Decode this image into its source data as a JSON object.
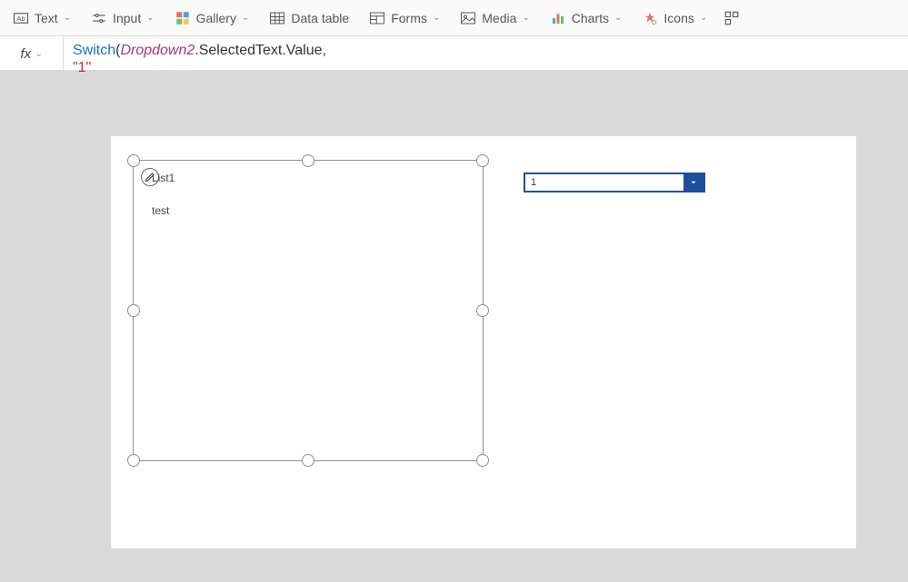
{
  "toolbar": {
    "items": [
      {
        "label": "Text"
      },
      {
        "label": "Input"
      },
      {
        "label": "Gallery"
      },
      {
        "label": "Data table"
      },
      {
        "label": "Forms"
      },
      {
        "label": "Media"
      },
      {
        "label": "Charts"
      },
      {
        "label": "Icons"
      }
    ]
  },
  "formulaBar": {
    "fxLabel": "fx",
    "formula_fn": "Switch",
    "formula_paren_open": "(",
    "formula_obj": "Dropdown2",
    "formula_props": ".SelectedText.Value",
    "formula_comma": ",",
    "formula_line2": "\"1\""
  },
  "gallery": {
    "title": "List1",
    "item": "test"
  },
  "dropdown": {
    "value": "1"
  }
}
